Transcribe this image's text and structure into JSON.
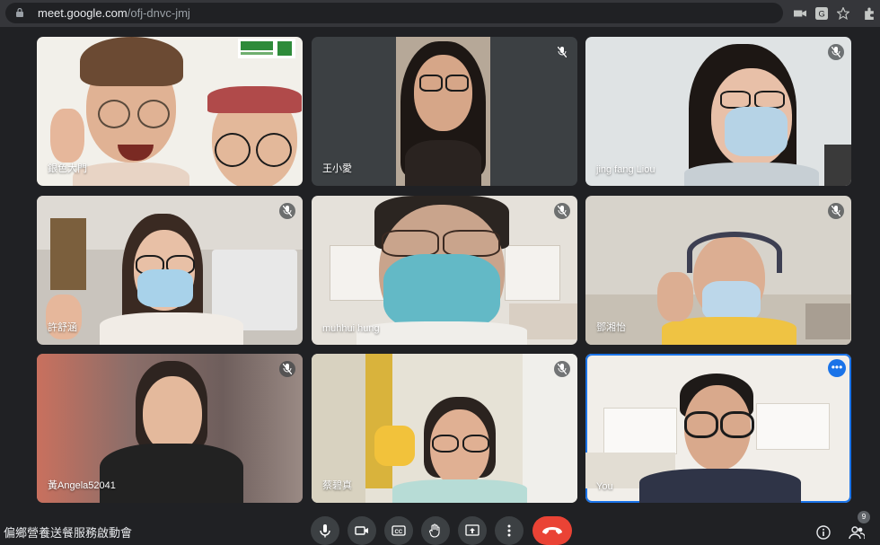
{
  "browser": {
    "url_host": "meet.google.com",
    "url_path": "/ofj-dnvc-jmj",
    "icons": [
      "lock-icon",
      "camera-icon",
      "translate-icon",
      "star-icon",
      "extensions-icon"
    ]
  },
  "participants": [
    {
      "name": "銀色大門",
      "muted": false,
      "logo_text": "門大色銀"
    },
    {
      "name": "王小愛",
      "muted": true
    },
    {
      "name": "jing fang Liou",
      "muted": true
    },
    {
      "name": "許舒涵",
      "muted": true
    },
    {
      "name": "muhhui hung",
      "muted": true
    },
    {
      "name": "鄧湘怡",
      "muted": true
    },
    {
      "name": "黃Angela52041",
      "muted": true
    },
    {
      "name": "蔡碧真",
      "muted": true
    },
    {
      "name": "You",
      "muted": false,
      "self": true
    }
  ],
  "meeting": {
    "title": "偏鄉營養送餐服務啟動會",
    "participant_count": "9"
  },
  "controls": [
    "microphone",
    "camera",
    "captions",
    "raise-hand",
    "present",
    "more-options",
    "leave-call"
  ],
  "colors": {
    "accent": "#1a73e8",
    "hangup": "#ea4335",
    "bg": "#202124"
  }
}
